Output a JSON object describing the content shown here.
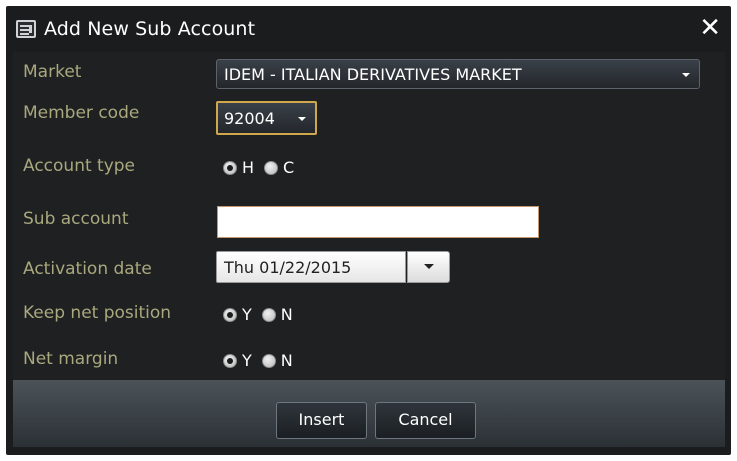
{
  "dialog": {
    "title": "Add New Sub Account",
    "close_icon": "close-icon"
  },
  "form": {
    "market": {
      "label": "Market",
      "value": "IDEM - ITALIAN DERIVATIVES MARKET"
    },
    "member_code": {
      "label": "Member code",
      "value": "92004"
    },
    "account_type": {
      "label": "Account type",
      "options": [
        {
          "label": "H",
          "checked": true
        },
        {
          "label": "C",
          "checked": false
        }
      ]
    },
    "sub_account": {
      "label": "Sub account",
      "value": "",
      "placeholder": ""
    },
    "activation_date": {
      "label": "Activation date",
      "value": "Thu 01/22/2015"
    },
    "keep_net_position": {
      "label": "Keep net position",
      "options": [
        {
          "label": "Y",
          "checked": true
        },
        {
          "label": "N",
          "checked": false
        }
      ]
    },
    "net_margin": {
      "label": "Net margin",
      "options": [
        {
          "label": "Y",
          "checked": true
        },
        {
          "label": "N",
          "checked": false
        }
      ]
    }
  },
  "footer": {
    "insert_label": "Insert",
    "cancel_label": "Cancel"
  },
  "colors": {
    "label": "#a9a87e",
    "accent_border": "#d0a74a",
    "dialog_bg": "#1f2021"
  }
}
